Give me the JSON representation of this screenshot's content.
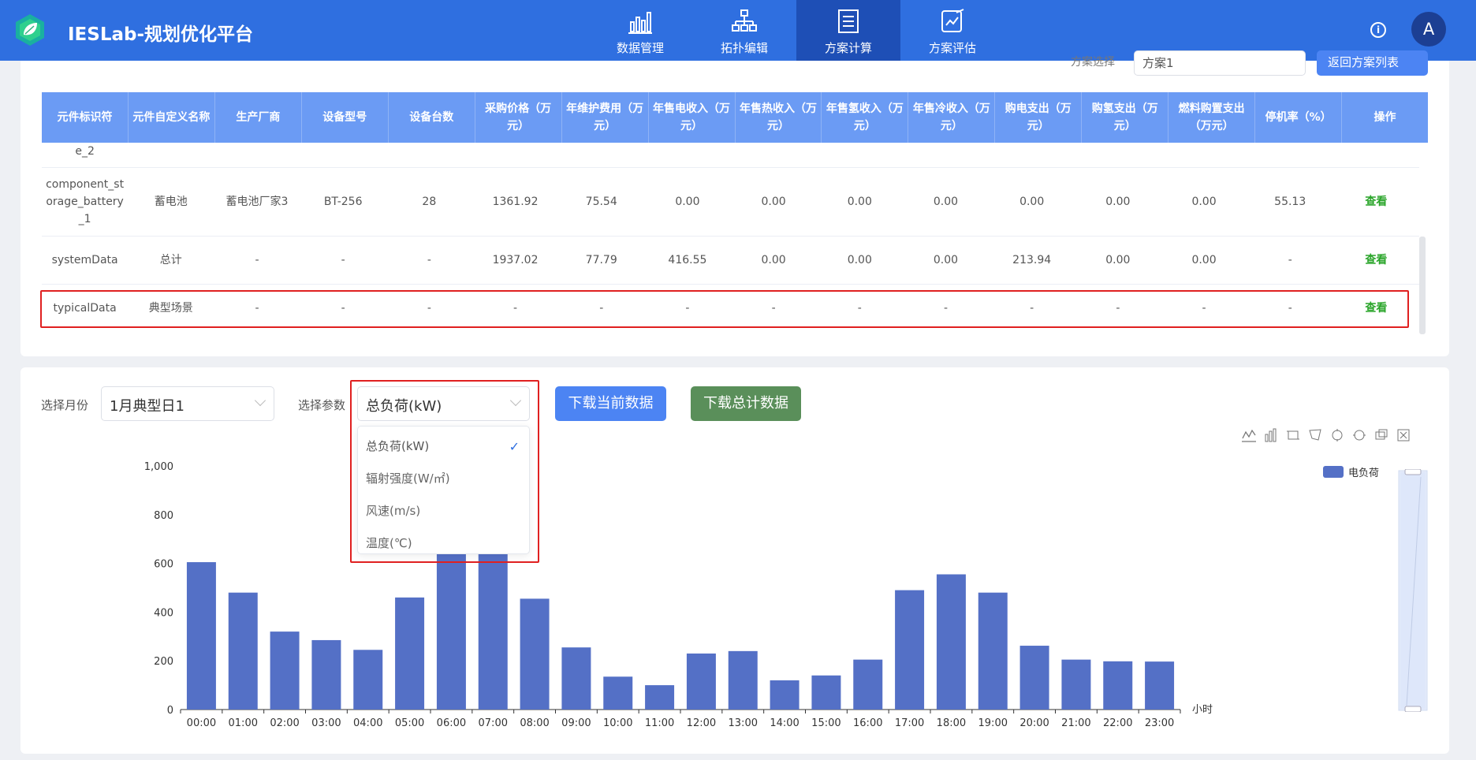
{
  "app": {
    "title": "IESLab-规划优化平台",
    "nav": [
      {
        "label": "数据管理",
        "icon": "bar-chart-icon"
      },
      {
        "label": "拓扑编辑",
        "icon": "topology-icon"
      },
      {
        "label": "方案计算",
        "icon": "document-list-icon"
      },
      {
        "label": "方案评估",
        "icon": "evaluate-icon"
      }
    ],
    "active_nav": "方案计算",
    "info_icon": "i",
    "avatar": "A"
  },
  "scheme_bar": {
    "label": "方案选择",
    "value": "方案1",
    "button": "返回方案列表"
  },
  "table": {
    "headers": [
      "元件标识符",
      "元件自定义名称",
      "生产厂商",
      "设备型号",
      "设备台数",
      "采购价格（万元）",
      "年维护费用（万元）",
      "年售电收入（万元）",
      "年售热收入（万元）",
      "年售氢收入（万元）",
      "年售冷收入（万元）",
      "购电支出（万元）",
      "购氢支出（万元）",
      "燃料购置支出（万元）",
      "停机率（%）",
      "操作"
    ],
    "rows": [
      [
        "e_2",
        "",
        "",
        "",
        "",
        "",
        "",
        "",
        "",
        "",
        "",
        "",
        "",
        "",
        "",
        ""
      ],
      [
        "component_storage_battery_1",
        "蓄电池",
        "蓄电池厂家3",
        "BT-256",
        "28",
        "1361.92",
        "75.54",
        "0.00",
        "0.00",
        "0.00",
        "0.00",
        "0.00",
        "0.00",
        "0.00",
        "55.13",
        "查看"
      ],
      [
        "systemData",
        "总计",
        "-",
        "-",
        "-",
        "1937.02",
        "77.79",
        "416.55",
        "0.00",
        "0.00",
        "0.00",
        "213.94",
        "0.00",
        "0.00",
        "-",
        "查看"
      ],
      [
        "typicalData",
        "典型场景",
        "-",
        "-",
        "-",
        "-",
        "-",
        "-",
        "-",
        "-",
        "-",
        "-",
        "-",
        "-",
        "-",
        "查看"
      ]
    ]
  },
  "controls": {
    "month_label": "选择月份",
    "month_value": "1月典型日1",
    "param_label": "选择参数",
    "param_value": "总负荷(kW)",
    "param_options": [
      "总负荷(kW)",
      "辐射强度(W/㎡)",
      "风速(m/s)",
      "温度(℃)"
    ],
    "download_current": "下载当前数据",
    "download_total": "下载总计数据"
  },
  "colors": {
    "header": "#2f6fe0",
    "table_header": "#6b9bf4",
    "bar": "#5470c6",
    "btn_current": "#4c84f3",
    "btn_total": "#5a8f5a",
    "highlight": "#e02020"
  },
  "chart_data": {
    "type": "bar",
    "categories": [
      "00:00",
      "01:00",
      "02:00",
      "03:00",
      "04:00",
      "05:00",
      "06:00",
      "07:00",
      "08:00",
      "09:00",
      "10:00",
      "11:00",
      "12:00",
      "13:00",
      "14:00",
      "15:00",
      "16:00",
      "17:00",
      "18:00",
      "19:00",
      "20:00",
      "21:00",
      "22:00",
      "23:00"
    ],
    "series": [
      {
        "name": "电负荷",
        "values": [
          605,
          480,
          320,
          285,
          245,
          460,
          640,
          640,
          455,
          255,
          135,
          100,
          230,
          240,
          120,
          140,
          205,
          490,
          555,
          480,
          262,
          205,
          198,
          197
        ]
      }
    ],
    "xlabel": "小时",
    "ylim": [
      0,
      1000
    ],
    "yticks": [
      "0",
      "200",
      "400",
      "600",
      "800",
      "1,000"
    ],
    "legend_position": "top-right",
    "grid": false
  }
}
